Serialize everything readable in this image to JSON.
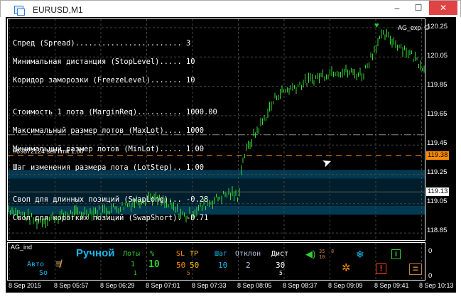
{
  "window": {
    "title": "EURUSD,M1",
    "minimize": "‒",
    "maximize": "☐",
    "close": "✕"
  },
  "info_lines": [
    "Спред (Spread)........................ 3",
    "Минимальная дистанция (StopLevel)..... 10",
    "Коридор заморозки (FreezeLevel)....... 10",
    "Стоимость 1 лота (MarginReq).......... 1000.00",
    "Максимальный размер лотов (MaxLot).... 1000",
    "Минимальный размер лотов (MinLot)..... 1.00",
    "Шаг изменения размера лота (LotStep).. 1.00",
    "Своп для длинных позиций (SwapLong)... -0.28",
    "Своп для коротких позиций (SwapShort). -0.71"
  ],
  "order_label": "#69872124 sell limit 1.00",
  "expert": {
    "name": "AG_exp",
    "smile": "☺",
    "heart": "♥"
  },
  "price_axis": [
    "120.25",
    "120.05",
    "119.85",
    "119.65",
    "119.45",
    "119.25",
    "119.05",
    "118.85"
  ],
  "price_tags": {
    "order": "119.38",
    "current": "119.13"
  },
  "time_axis": [
    "8 Sep 2015",
    "8 Sep 05:57",
    "8 Sep 06:29",
    "8 Sep 07:01",
    "8 Sep 07:33",
    "8 Sep 08:05",
    "8 Sep 08:37",
    "8 Sep 09:09",
    "8 Sep 09:41",
    "8 Sep 10:13"
  ],
  "panel": {
    "name": "AG_ind",
    "mode": "Ручной",
    "auto": "Авто",
    "so": "So",
    "lots_label": "Лоты",
    "lots": "1",
    "lots_sub": "1",
    "pct_label": "%",
    "pct": "10",
    "sl_label": "SL",
    "sl": "50",
    "tp_label": "TP",
    "tp": "50",
    "tp_sub": "5",
    "step_label": "Шаг",
    "step": "10",
    "dev_label": "Отклон",
    "dev": "2",
    "dist_label": "Дист",
    "dist": "30",
    "dist_sub": "5",
    "sound_nums": {
      "a": "35",
      "b": "10",
      "c": "8"
    },
    "scale_top": "0",
    "scale_bottom": "0"
  },
  "colors": {
    "bars": "#33dd33",
    "band": "#003a52",
    "band_dark": "#001e2c",
    "order_line": "#ff8c00"
  }
}
